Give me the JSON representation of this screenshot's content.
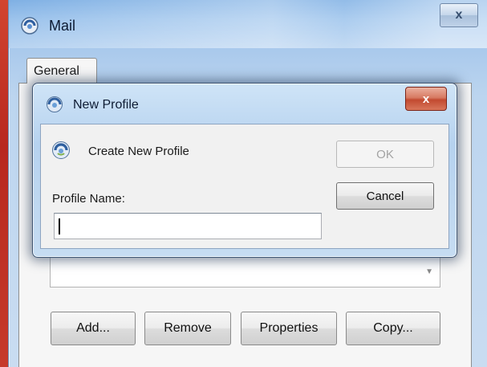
{
  "mail_window": {
    "title": "Mail",
    "close_label": "x",
    "tabs": [
      {
        "label": "General"
      }
    ],
    "buttons": {
      "add": "Add...",
      "remove": "Remove",
      "properties": "Properties",
      "copy": "Copy..."
    },
    "profile_list_value": ""
  },
  "dialog": {
    "title": "New Profile",
    "close_label": "x",
    "heading": "Create New Profile",
    "profile_name_label": "Profile Name:",
    "profile_name_value": "",
    "ok_label": "OK",
    "ok_enabled": false,
    "cancel_label": "Cancel"
  },
  "icons": {
    "mail_title": "mail-profile-icon",
    "dialog_title": "outlook-globe-icon",
    "create_profile": "outlook-globe-icon"
  },
  "colors": {
    "close_button_red": "#c24a30",
    "title_bar_blue": "#9cc3ec",
    "desktop_red": "#c9332e"
  }
}
